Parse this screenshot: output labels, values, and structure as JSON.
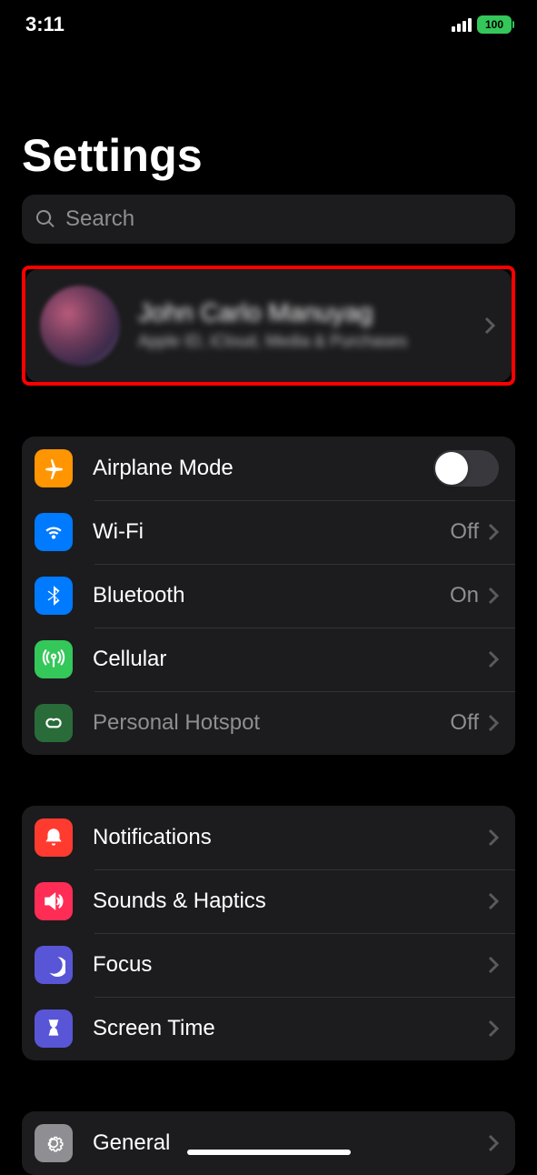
{
  "status": {
    "time": "3:11",
    "battery": "100"
  },
  "page_title": "Settings",
  "search": {
    "placeholder": "Search"
  },
  "profile": {
    "name": "John Carlo Manuyag",
    "subtitle": "Apple ID, iCloud, Media & Purchases"
  },
  "groups": {
    "connectivity": [
      {
        "label": "Airplane Mode",
        "value": "",
        "type": "toggle",
        "on": false,
        "icon": "airplane",
        "color": "orange"
      },
      {
        "label": "Wi-Fi",
        "value": "Off",
        "type": "nav",
        "icon": "wifi",
        "color": "blue"
      },
      {
        "label": "Bluetooth",
        "value": "On",
        "type": "nav",
        "icon": "bluetooth",
        "color": "blue"
      },
      {
        "label": "Cellular",
        "value": "",
        "type": "nav",
        "icon": "cellular",
        "color": "green"
      },
      {
        "label": "Personal Hotspot",
        "value": "Off",
        "type": "nav",
        "icon": "hotspot",
        "color": "darkgreen",
        "disabled": true
      }
    ],
    "attention": [
      {
        "label": "Notifications",
        "value": "",
        "type": "nav",
        "icon": "notifications",
        "color": "red"
      },
      {
        "label": "Sounds & Haptics",
        "value": "",
        "type": "nav",
        "icon": "sounds",
        "color": "pink"
      },
      {
        "label": "Focus",
        "value": "",
        "type": "nav",
        "icon": "focus",
        "color": "indigo"
      },
      {
        "label": "Screen Time",
        "value": "",
        "type": "nav",
        "icon": "screentime",
        "color": "indigo"
      }
    ],
    "general": [
      {
        "label": "General",
        "value": "",
        "type": "nav",
        "icon": "general",
        "color": "gray"
      }
    ]
  }
}
